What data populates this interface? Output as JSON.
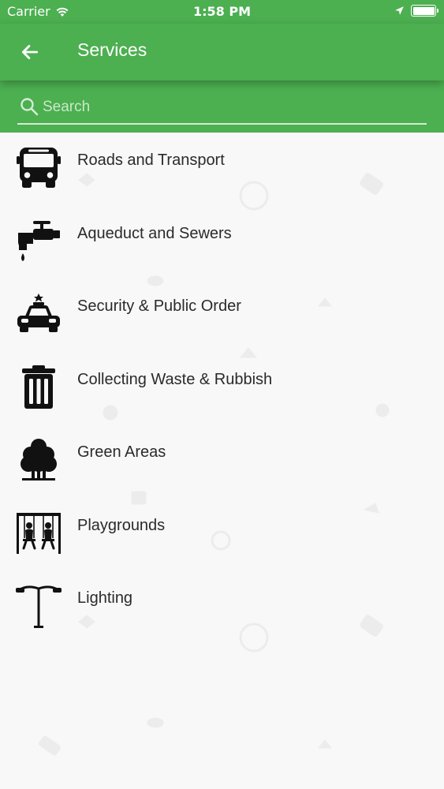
{
  "status_bar": {
    "carrier": "Carrier",
    "time": "1:58 PM"
  },
  "header": {
    "title": "Services",
    "back_icon": "arrow-left-icon"
  },
  "search": {
    "placeholder": "Search",
    "value": "",
    "icon": "search-icon"
  },
  "colors": {
    "primary": "#4caf50",
    "background": "#f8f8f8",
    "text": "#2a2a2a"
  },
  "services": [
    {
      "label": "Roads and Transport",
      "icon": "bus-icon"
    },
    {
      "label": "Aqueduct and Sewers",
      "icon": "faucet-icon"
    },
    {
      "label": "Security & Public Order",
      "icon": "police-car-icon"
    },
    {
      "label": "Collecting Waste & Rubbish",
      "icon": "trash-bin-icon"
    },
    {
      "label": "Green Areas",
      "icon": "tree-icon"
    },
    {
      "label": "Playgrounds",
      "icon": "swings-icon"
    },
    {
      "label": "Lighting",
      "icon": "street-lamp-icon"
    }
  ]
}
